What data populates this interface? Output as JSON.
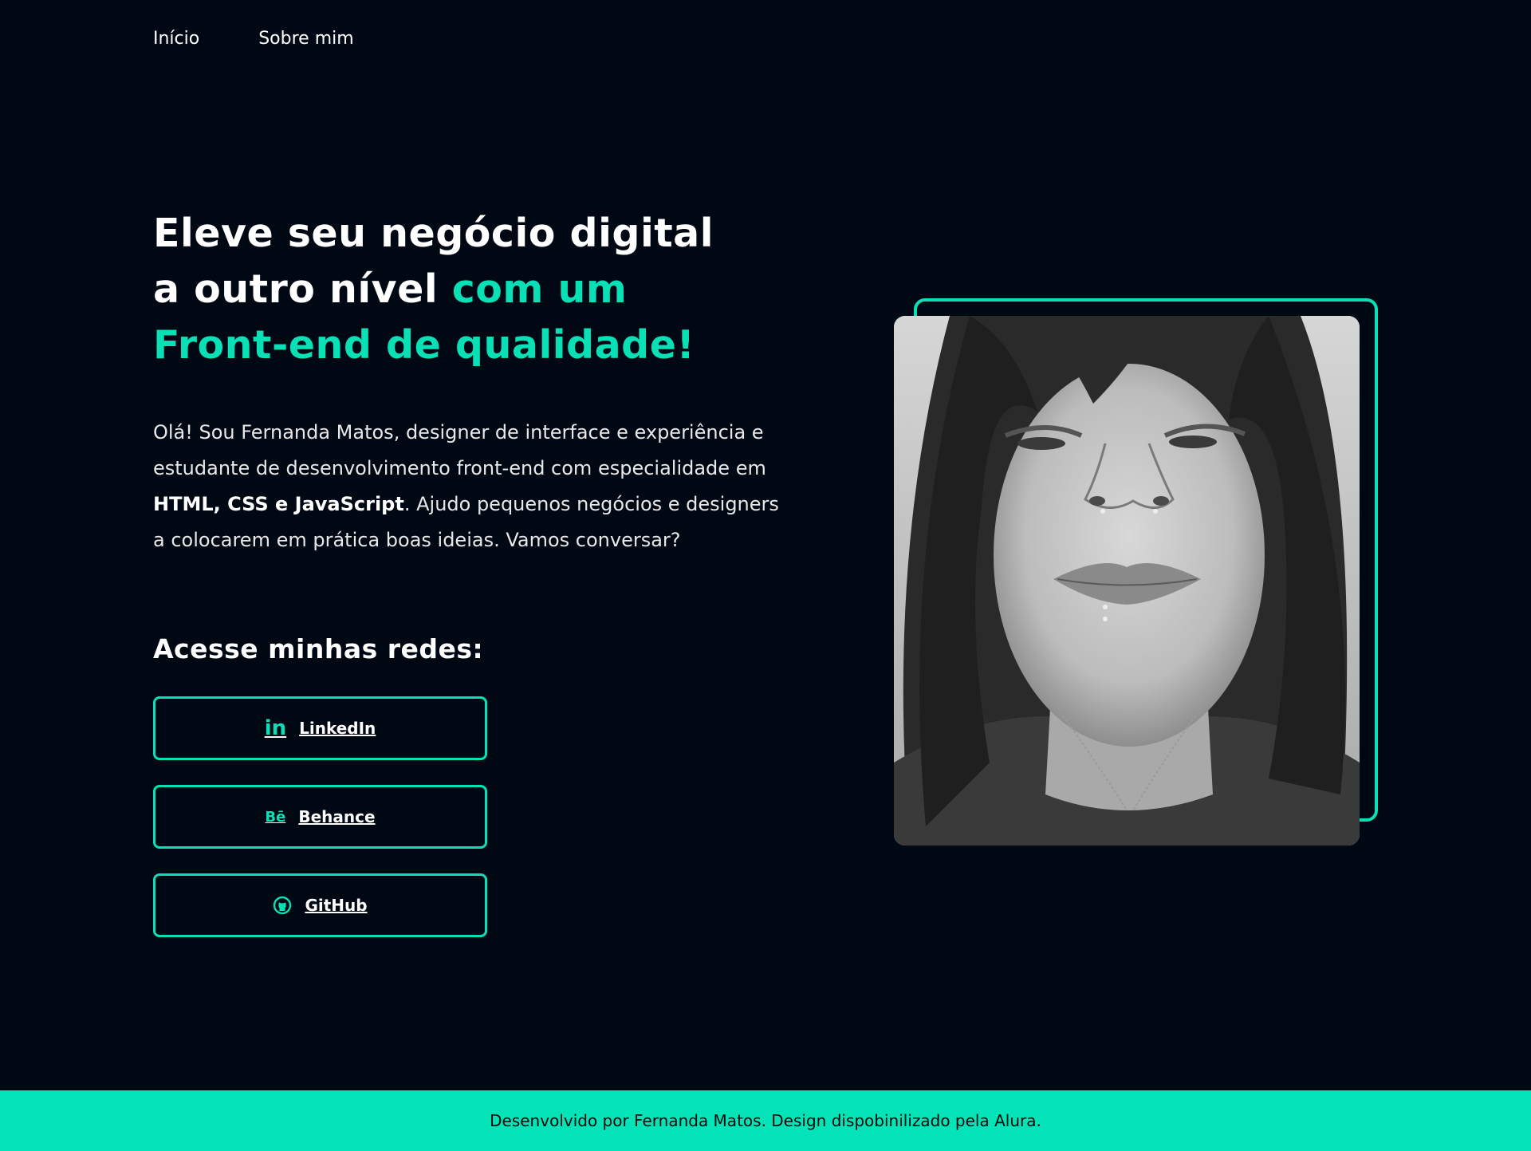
{
  "nav": {
    "items": [
      {
        "label": "Início"
      },
      {
        "label": "Sobre mim"
      }
    ]
  },
  "hero": {
    "headline_line1": "Eleve seu negócio digital",
    "headline_line2_plain": "a outro nível ",
    "headline_line2_accent": "com um",
    "headline_line3_accent": "Front-end de qualidade!",
    "intro_part1": "Olá! Sou Fernanda Matos, designer de interface e experiência e estudante de desenvolvimento front-end com especialidade em ",
    "intro_strong": "HTML, CSS e JavaScript",
    "intro_part2": ". Ajudo pequenos negócios e designers a colocarem em prática boas ideias. Vamos conversar?"
  },
  "social": {
    "title": "Acesse minhas redes:",
    "buttons": [
      {
        "label": "LinkedIn",
        "icon": "linkedin-icon",
        "icon_text": "in"
      },
      {
        "label": "Behance",
        "icon": "behance-icon",
        "icon_text": "Bē"
      },
      {
        "label": "GitHub",
        "icon": "github-icon"
      }
    ]
  },
  "portrait": {
    "icon": "portrait-photo"
  },
  "footer": {
    "text": "Desenvolvido por Fernanda Matos. Design dispobinilizado pela Alura."
  },
  "colors": {
    "background": "#000814",
    "accent": "#0ae0b6",
    "footer_bg": "#05e3b8"
  }
}
